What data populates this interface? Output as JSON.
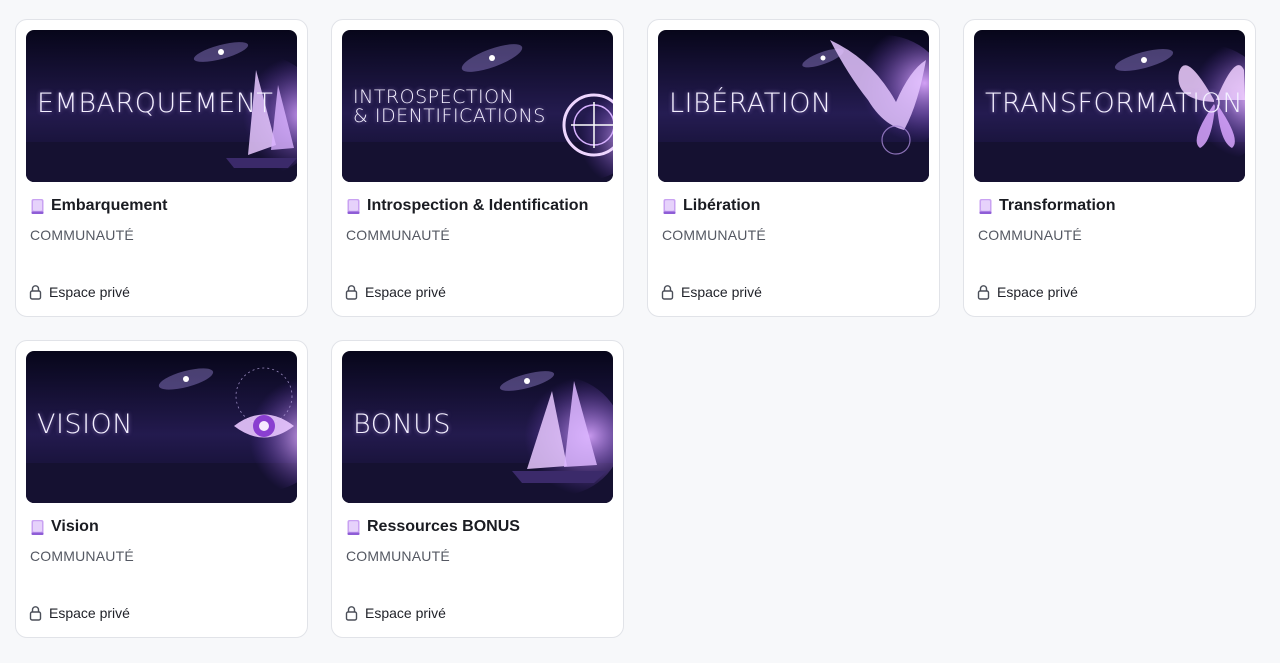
{
  "spaces": [
    {
      "banner_text": "EMBARQUEMENT",
      "title": "Embarquement",
      "type": "COMMUNAUTÉ",
      "privacy": "Espace privé",
      "emblem": "ship"
    },
    {
      "banner_text_lines": [
        "INTROSPECTION",
        "& IDENTIFICATIONS"
      ],
      "title": "Introspection & Identification",
      "type": "COMMUNAUTÉ",
      "privacy": "Espace privé",
      "emblem": "compass"
    },
    {
      "banner_text": "LIBÉRATION",
      "title": "Libération",
      "type": "COMMUNAUTÉ",
      "privacy": "Espace privé",
      "emblem": "bird"
    },
    {
      "banner_text": "TRANSFORMATION",
      "title": "Transformation",
      "type": "COMMUNAUTÉ",
      "privacy": "Espace privé",
      "emblem": "butterfly"
    },
    {
      "banner_text": "VISION",
      "title": "Vision",
      "type": "COMMUNAUTÉ",
      "privacy": "Espace privé",
      "emblem": "eye"
    },
    {
      "banner_text": "BONUS",
      "title": "Ressources BONUS",
      "type": "COMMUNAUTÉ",
      "privacy": "Espace privé",
      "emblem": "ship"
    }
  ],
  "icons": {
    "title_icon": "book-icon",
    "privacy_icon": "lock-icon"
  },
  "colors": {
    "accent_purple": "#c27cf5",
    "banner_dark": "#0e0b22",
    "card_border": "#e1e3e8"
  }
}
